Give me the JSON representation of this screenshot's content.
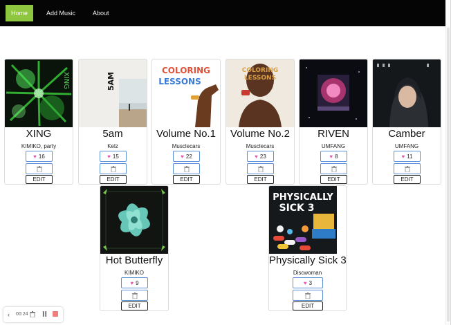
{
  "nav": {
    "home": "Home",
    "add_music": "Add Music",
    "about": "About",
    "active_color": "#8ec63f"
  },
  "buttons": {
    "edit": "EDIT",
    "like_icon": "heart-icon",
    "delete_icon": "trash-icon"
  },
  "albums": [
    {
      "title": "XING",
      "artist": "KIMIKO, party",
      "likes": "16",
      "cover_text": "XING"
    },
    {
      "title": "5am",
      "artist": "Kelz",
      "likes": "15",
      "cover_text": "5AM"
    },
    {
      "title": "Volume No.1",
      "artist": "Musclecars",
      "likes": "22",
      "cover_text": "COLORING LESSONS"
    },
    {
      "title": "Volume No.2",
      "artist": "Musclecars",
      "likes": "23",
      "cover_text": "COLORING LESSONS"
    },
    {
      "title": "RIVEN",
      "artist": "UMFANG",
      "likes": "8",
      "cover_text": ""
    },
    {
      "title": "Camber",
      "artist": "UMFANG",
      "likes": "11",
      "cover_text": ""
    },
    {
      "title": "Hot Butterfly",
      "artist": "KIMIKO",
      "likes": "9",
      "cover_text": ""
    },
    {
      "title": "Physically Sick 3",
      "artist": "Discwoman",
      "likes": "3",
      "cover_text": "PHYSICALLY SICK 3"
    }
  ],
  "player": {
    "time": "00:24",
    "back_icon": "chevron-left-icon",
    "delete_icon": "trash-icon",
    "pause_icon": "pause-icon",
    "stop_icon": "stop-icon"
  }
}
